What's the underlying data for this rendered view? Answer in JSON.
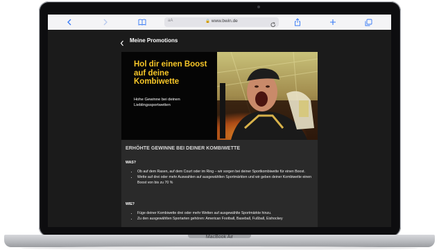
{
  "browser": {
    "text_size_label": "aA",
    "url": "www.bwin.de"
  },
  "page": {
    "title": "Meine Promotions"
  },
  "hero": {
    "headline": "Hol dir einen Boost auf deine Kombiwette",
    "subline": "Hohe Gewinne bei deinen Lieblingssportwetten"
  },
  "content": {
    "heading": "ERHÖHTE GEWINNE BEI DEINER KOMBIWETTE",
    "what_label": "WAS?",
    "what_items": [
      "Ob auf dem Rasen, auf dem Court oder im Ring – wir sorgen bei deiner Sportkombiwette für einen Boost.",
      "Wette auf drei oder mehr Auswahlen auf ausgewählten Sportmärkten und wir geben deiner Kombiwette einen Boost von bis zu 70 %"
    ],
    "how_label": "WIE?",
    "how_items": [
      "Füge deiner Kombiwette drei oder mehr Wetten auf ausgewählte Sportmärkte hinzu.",
      "Zu den ausgewählten Sportarten gehören: American Football, Baseball, Fußball, Eishockey"
    ]
  },
  "device": {
    "label": "MacBook Air"
  },
  "colors": {
    "accent": "#f7c628",
    "page_bg": "#1b1b1b",
    "panel_bg": "#2a2a2a"
  }
}
